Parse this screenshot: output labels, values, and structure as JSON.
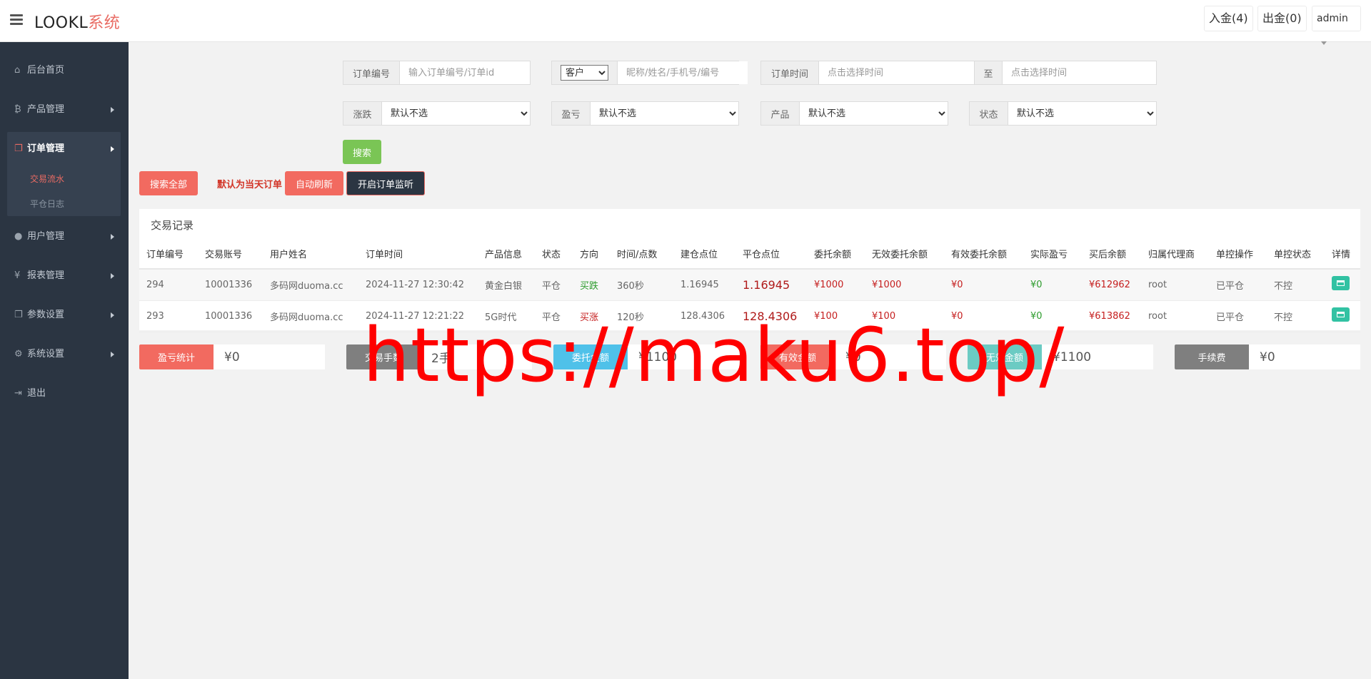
{
  "header": {
    "logo_part1": "LOOKL",
    "logo_part2": "系统",
    "deposit_label": "入金(4)",
    "withdraw_label": "出金(0)",
    "user_label": "admin"
  },
  "sidebar": {
    "items": [
      {
        "icon": "dashboard-icon",
        "glyph": "⌂",
        "label": "后台首页"
      },
      {
        "icon": "bitcoin-icon",
        "glyph": "₿",
        "label": "产品管理"
      },
      {
        "icon": "copy-icon",
        "glyph": "❐",
        "label": "订单管理"
      },
      {
        "icon": "user-icon",
        "glyph": "●",
        "label": "用户管理"
      },
      {
        "icon": "yen-icon",
        "glyph": "¥",
        "label": "报表管理"
      },
      {
        "icon": "files-icon",
        "glyph": "❐",
        "label": "参数设置"
      },
      {
        "icon": "cogs-icon",
        "glyph": "⚙",
        "label": "系统设置"
      },
      {
        "icon": "sign-out-icon",
        "glyph": "⇥",
        "label": "退出"
      }
    ],
    "sub_items": [
      "交易流水",
      "平仓日志"
    ]
  },
  "filters": {
    "order_no_label": "订单编号",
    "order_no_placeholder": "输入订单编号/订单id",
    "customer_select_value": "客户",
    "customer_placeholder": "昵称/姓名/手机号/编号",
    "order_time_label": "订单时间",
    "time_placeholder": "点击选择时间",
    "to_label": "至",
    "rise_fall_label": "涨跌",
    "profit_label": "盈亏",
    "product_label": "产品",
    "status_label": "状态",
    "default_option": "默认不选",
    "search_btn": "搜索"
  },
  "actions": {
    "search_all": "搜索全部",
    "notice": "默认为当天订单",
    "auto_refresh": "自动刷新",
    "monitor": "开启订单监听"
  },
  "table": {
    "title": "交易记录",
    "headers": [
      "订单编号",
      "交易账号",
      "用户姓名",
      "订单时间",
      "产品信息",
      "状态",
      "方向",
      "时间/点数",
      "建仓点位",
      "平仓点位",
      "委托余额",
      "无效委托余额",
      "有效委托余额",
      "实际盈亏",
      "买后余额",
      "归属代理商",
      "单控操作",
      "单控状态",
      "详情"
    ],
    "rows": [
      [
        "294",
        "10001336",
        "多码网duoma.cc",
        "2024-11-27 12:30:42",
        "黄金白银",
        "平仓",
        "买跌",
        "360秒",
        "1.16945",
        "1.16945",
        "¥1000",
        "¥1000",
        "¥0",
        "¥0",
        "¥612962",
        "root",
        "已平仓",
        "不控"
      ],
      [
        "293",
        "10001336",
        "多码网duoma.cc",
        "2024-11-27 12:21:22",
        "5G时代",
        "平仓",
        "买涨",
        "120秒",
        "128.4306",
        "128.4306",
        "¥100",
        "¥100",
        "¥0",
        "¥0",
        "¥613862",
        "root",
        "已平仓",
        "不控"
      ]
    ]
  },
  "stats": [
    {
      "label": "盈亏统计",
      "value": "¥0",
      "color": "#f26a60"
    },
    {
      "label": "交易手数",
      "value": "2手",
      "color": "#7f7f7f"
    },
    {
      "label": "委托金额",
      "value": "¥1100",
      "color": "#4fc1e9"
    },
    {
      "label": "有效金额",
      "value": "¥0",
      "color": "#f26a60"
    },
    {
      "label": "无效金额",
      "value": "¥1100",
      "color": "#6bcbc3"
    },
    {
      "label": "手续费",
      "value": "¥0",
      "color": "#7f7f7f"
    }
  ],
  "watermark": "https://maku6.top/",
  "colors": {
    "accent": "#e96b63",
    "sidebar_bg": "#2b3542",
    "search_green": "#7ac555",
    "detail_teal": "#32c2a3"
  }
}
